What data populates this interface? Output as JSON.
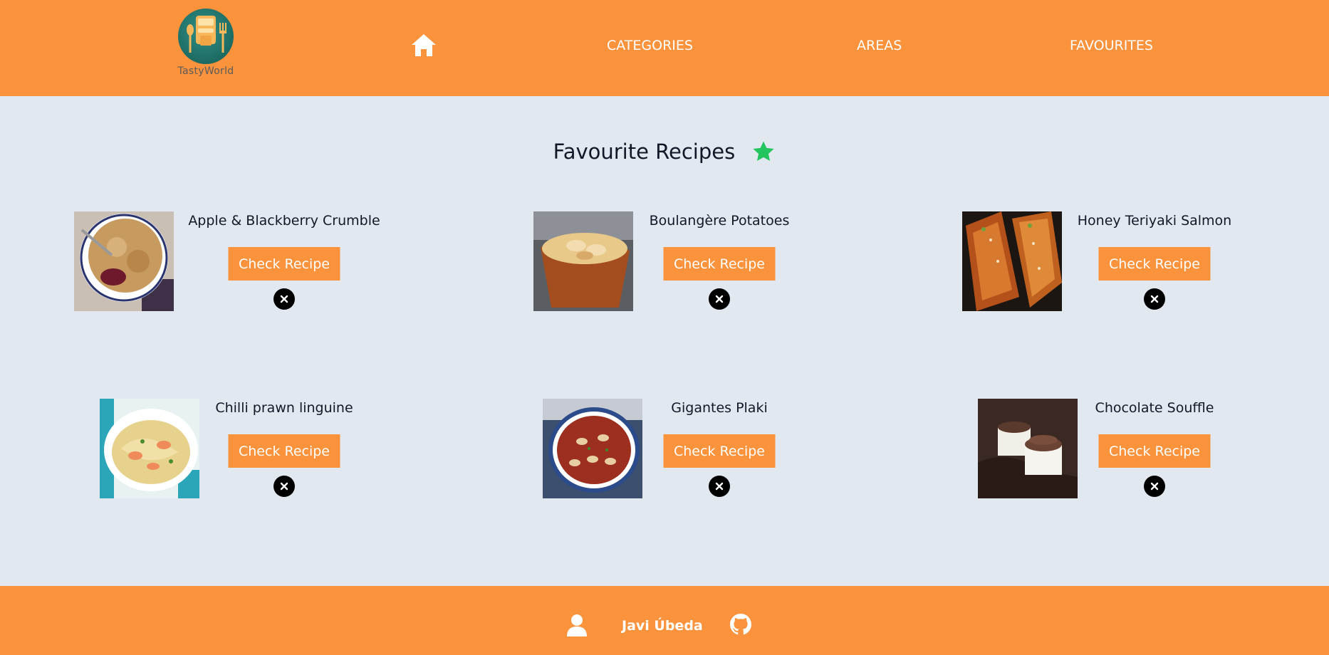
{
  "header": {
    "logo_text": "TastyWorld",
    "nav": {
      "categories": "CATEGORIES",
      "areas": "AREAS",
      "favourites": "FAVOURITES"
    }
  },
  "main": {
    "title": "Favourite Recipes",
    "recipes": [
      {
        "name": "Apple & Blackberry Crumble",
        "button": "Check Recipe"
      },
      {
        "name": "Boulangère Potatoes",
        "button": "Check Recipe"
      },
      {
        "name": "Honey Teriyaki Salmon",
        "button": "Check Recipe"
      },
      {
        "name": "Chilli prawn linguine",
        "button": "Check Recipe"
      },
      {
        "name": "Gigantes Plaki",
        "button": "Check Recipe"
      },
      {
        "name": "Chocolate Souffle",
        "button": "Check Recipe"
      }
    ]
  },
  "footer": {
    "author": "Javi Úbeda"
  },
  "colors": {
    "brand_orange": "#fb923c",
    "background": "#e2e8f0",
    "star_green": "#22c55e",
    "remove_black": "#000000"
  },
  "icons": [
    "home-icon",
    "star-icon",
    "close-icon",
    "user-icon",
    "github-icon"
  ]
}
